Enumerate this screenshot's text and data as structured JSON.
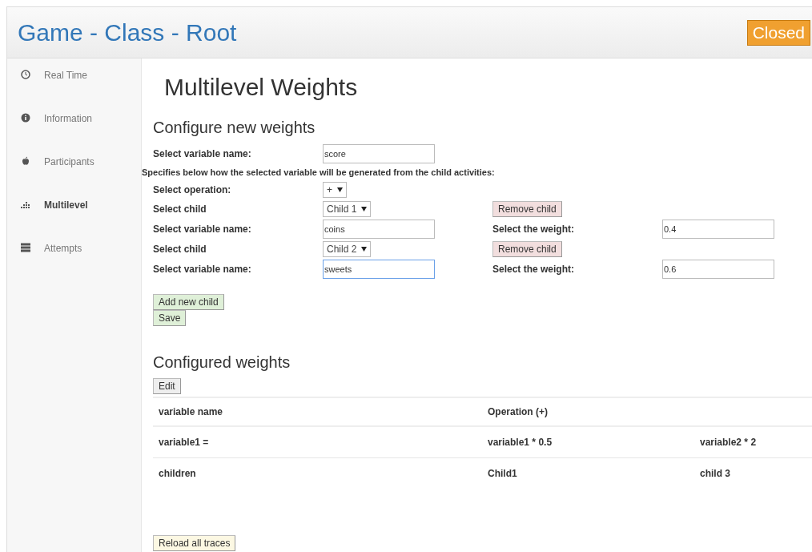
{
  "header": {
    "title": "Game - Class - Root",
    "status_badge": "Closed"
  },
  "sidebar": {
    "items": [
      {
        "label": "Real Time",
        "kind": "clock",
        "selected": false
      },
      {
        "label": "Information",
        "kind": "info",
        "selected": false
      },
      {
        "label": "Participants",
        "kind": "apple",
        "selected": false
      },
      {
        "label": "Multilevel",
        "kind": "chart",
        "selected": true
      },
      {
        "label": "Attempts",
        "kind": "stack",
        "selected": false
      }
    ]
  },
  "page_title": "Multilevel Weights",
  "configure": {
    "heading": "Configure new weights",
    "variable_label": "Select variable name:",
    "variable_value": "score",
    "hint": "Specifies below how the selected variable will be generated from the child activities:",
    "operation_label": "Select operation:",
    "operation_value": "+",
    "children": [
      {
        "child_label": "Select child",
        "child_value": "Child 1",
        "remove": "Remove child",
        "variable_label": "Select variable name:",
        "variable_value": "coins",
        "focused": false,
        "weight_label": "Select the weight:",
        "weight_value": "0.4"
      },
      {
        "child_label": "Select child",
        "child_value": "Child 2",
        "remove": "Remove child",
        "variable_label": "Select variable name:",
        "variable_value": "sweets",
        "focused": true,
        "weight_label": "Select the weight:",
        "weight_value": "0.6"
      }
    ],
    "add_button": "Add new child",
    "save_button": "Save"
  },
  "configured": {
    "heading": "Configured weights",
    "edit_button": "Edit",
    "table": {
      "columns": [
        "variable name",
        "Operation (+)"
      ],
      "rows": [
        [
          "variable1 =",
          "variable1 * 0.5",
          "variable2 * 2"
        ],
        [
          "children",
          "Child1",
          "child 3"
        ]
      ]
    }
  },
  "reload_button": "Reload all traces"
}
